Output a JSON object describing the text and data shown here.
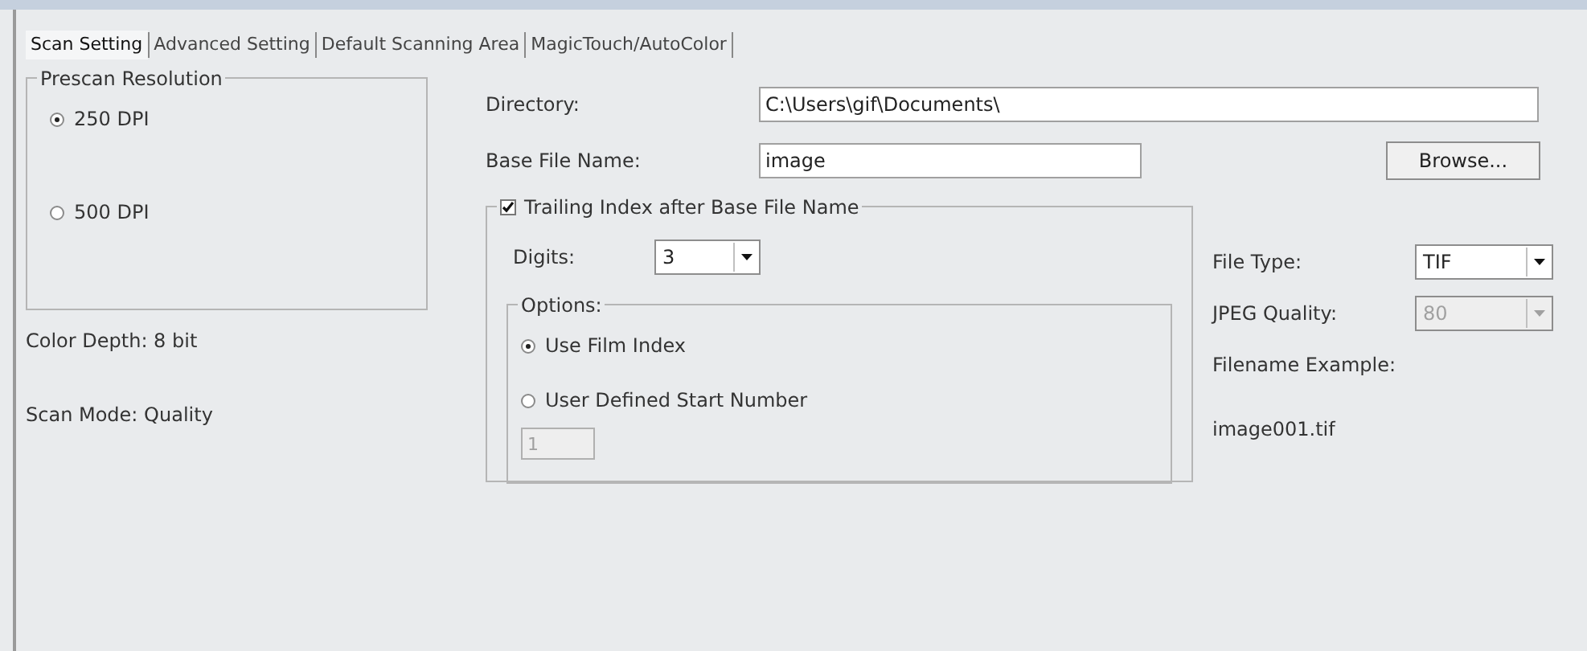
{
  "tabs": [
    {
      "label": "Scan Setting",
      "selected": true
    },
    {
      "label": "Advanced Setting",
      "selected": false
    },
    {
      "label": "Default Scanning Area",
      "selected": false
    },
    {
      "label": "MagicTouch/AutoColor",
      "selected": false
    }
  ],
  "prescan_resolution": {
    "title": "Prescan Resolution",
    "options": [
      {
        "label": "250 DPI",
        "selected": true
      },
      {
        "label": "500 DPI",
        "selected": false
      }
    ]
  },
  "color_depth": "Color Depth: 8 bit",
  "scan_mode": "Scan Mode: Quality",
  "directory": {
    "label": "Directory:",
    "value": "C:\\Users\\gif\\Documents\\"
  },
  "base_file_name": {
    "label": "Base File Name:",
    "value": "image"
  },
  "browse_button": "Browse...",
  "trailing_index": {
    "label": "Trailing Index after Base File Name",
    "checked": true,
    "digits": {
      "label": "Digits:",
      "value": "3"
    },
    "options": {
      "title": "Options:",
      "items": [
        {
          "label": "Use Film Index",
          "selected": true
        },
        {
          "label": "User Defined Start Number",
          "selected": false
        }
      ],
      "start_number": {
        "value": "1",
        "disabled": true
      }
    }
  },
  "file_type": {
    "label": "File Type:",
    "value": "TIF",
    "disabled": false
  },
  "jpeg_quality": {
    "label": "JPEG Quality:",
    "value": "80",
    "disabled": true
  },
  "filename_example": {
    "label": "Filename Example:",
    "value": "image001.tif"
  }
}
